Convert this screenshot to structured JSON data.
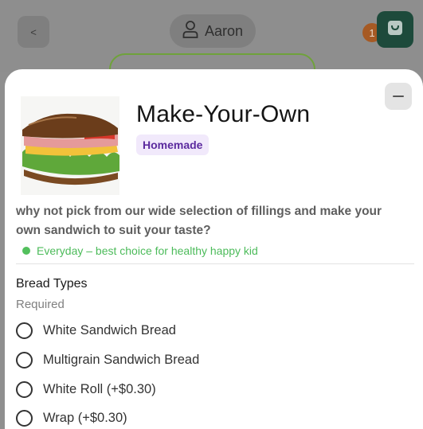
{
  "header": {
    "back_label": "<",
    "user_name": "Aaron",
    "cart_count": "1"
  },
  "product": {
    "title": "Make-Your-Own",
    "tag": "Homemade",
    "description": "why not pick from our wide selection of fillings and make your own sandwich to suit your taste?",
    "availability": "Everyday – best choice for healthy happy kid"
  },
  "options_group": {
    "title": "Bread Types",
    "requirement": "Required",
    "options": [
      {
        "label": "White Sandwich Bread"
      },
      {
        "label": "Multigrain Sandwich Bread"
      },
      {
        "label": "White Roll (+$0.30)"
      },
      {
        "label": "Wrap (+$0.30)"
      }
    ]
  },
  "colors": {
    "cart_button": "#1d4a3b",
    "tag_bg": "#f1e9fb",
    "tag_text": "#5b2a9e",
    "availability": "#4cbb5a"
  }
}
